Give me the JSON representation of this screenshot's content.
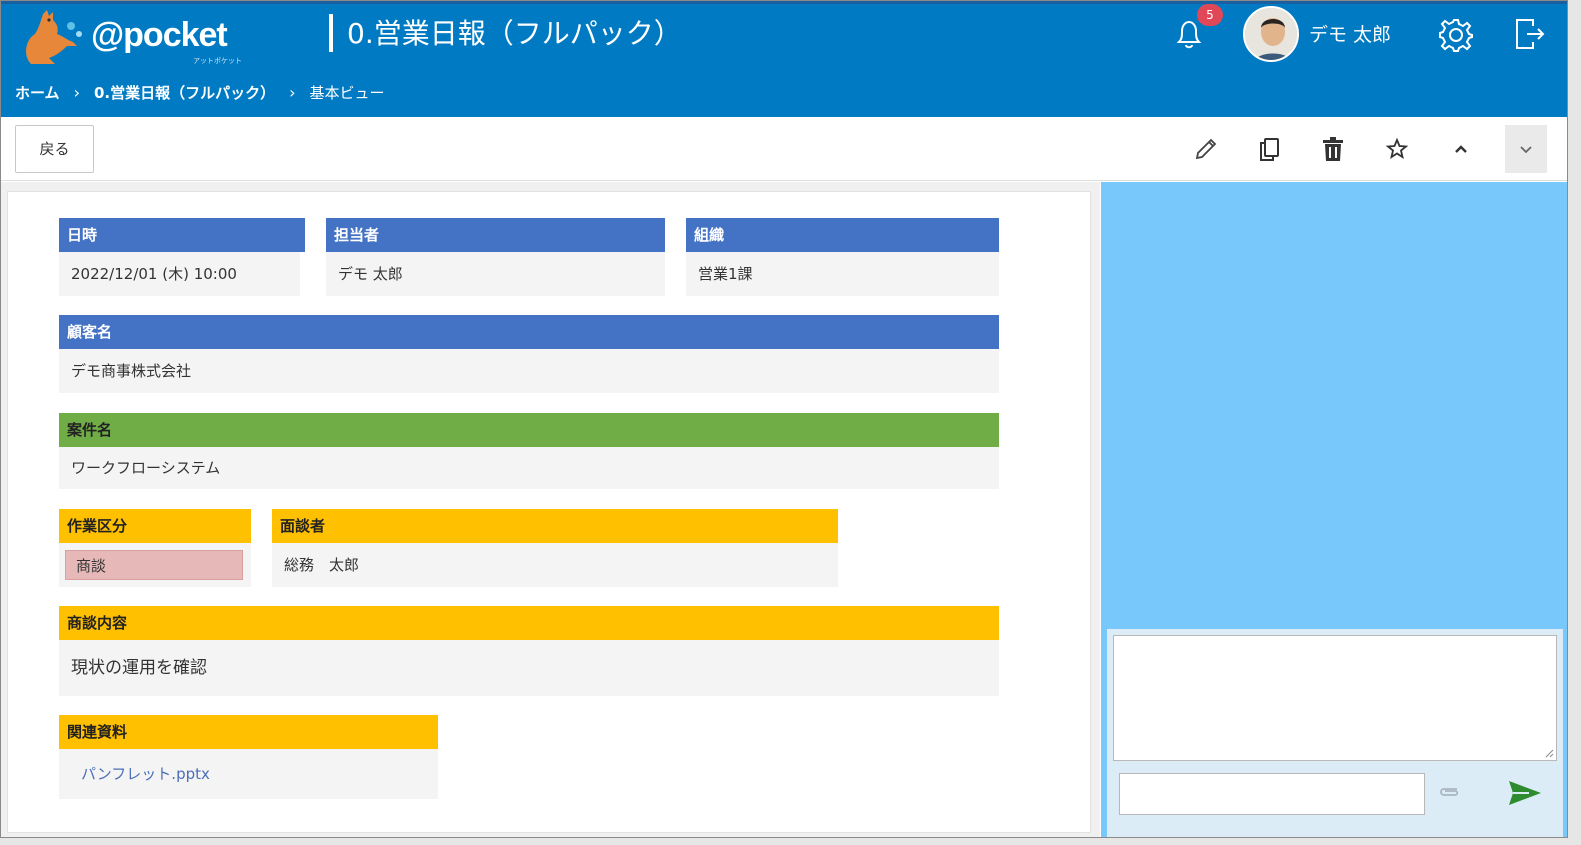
{
  "header": {
    "logo_text": "@pocket",
    "logo_sub": "アットポケット",
    "page_title": "0.営業日報（フルパック）",
    "notification_count": "5",
    "user_name": "デモ 太郎"
  },
  "breadcrumb": {
    "home": "ホーム",
    "app": "0.営業日報（フルパック）",
    "view": "基本ビュー",
    "separator": "›"
  },
  "toolbar": {
    "back_label": "戻る",
    "icons": [
      "pencil-icon",
      "copy-icon",
      "trash-icon",
      "star-icon",
      "chevron-up-icon",
      "chevron-down-icon"
    ]
  },
  "record": {
    "datetime": {
      "label": "日時",
      "value": "2022/12/01 (木) 10:00"
    },
    "assignee": {
      "label": "担当者",
      "value": "デモ 太郎"
    },
    "org": {
      "label": "組織",
      "value": "営業1課"
    },
    "customer": {
      "label": "顧客名",
      "value": "デモ商事株式会社"
    },
    "project": {
      "label": "案件名",
      "value": "ワークフローシステム"
    },
    "work_type": {
      "label": "作業区分",
      "value": "商談"
    },
    "interviewee": {
      "label": "面談者",
      "value": "総務　太郎"
    },
    "details": {
      "label": "商談内容",
      "value": "現状の運用を確認"
    },
    "attachments": {
      "label": "関連資料",
      "value": "パンフレット.pptx"
    }
  },
  "comment": {
    "textarea_value": "",
    "input_value": ""
  },
  "colors": {
    "header_bg": "#007ac2",
    "label_blue": "#4472c4",
    "label_green": "#70ad47",
    "label_yellow": "#ffc000",
    "right_panel": "#78c8fb",
    "send_green": "#2e8b2e",
    "badge_red": "#e04858"
  }
}
